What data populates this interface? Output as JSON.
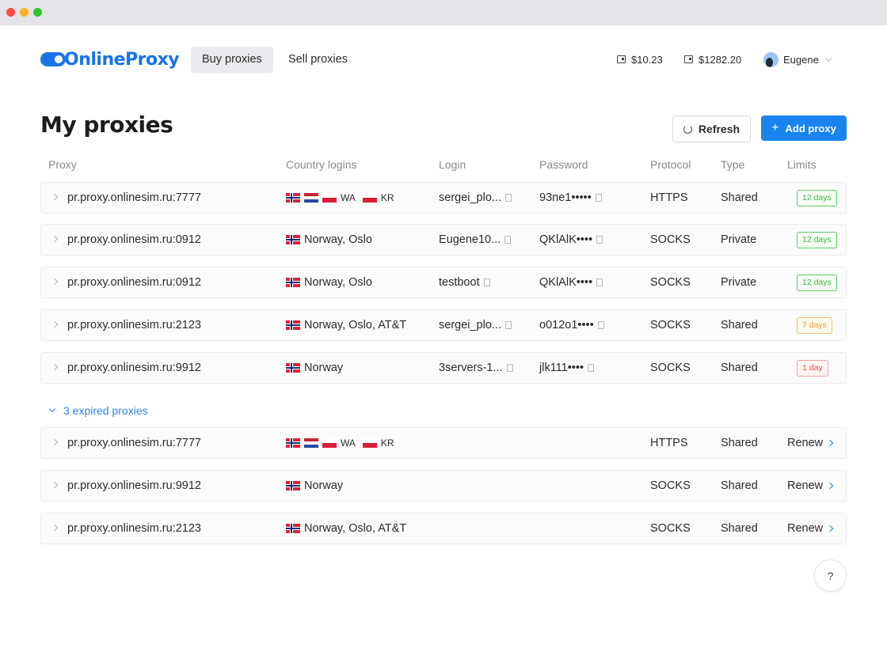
{
  "window": {
    "controls": [
      "close",
      "minimize",
      "maximize"
    ]
  },
  "header": {
    "logo_text": "OnlineProxy",
    "nav": [
      {
        "label": "Buy proxies",
        "active": true
      },
      {
        "label": "Sell proxies",
        "active": false
      }
    ],
    "balances": [
      {
        "icon": "wallet-icon",
        "value": "$10.23"
      },
      {
        "icon": "wallet-icon",
        "value": "$1282.20"
      }
    ],
    "user": {
      "name": "Eugene",
      "icon": "chevron-down-icon"
    }
  },
  "page": {
    "title": "My proxies",
    "refresh_label": "Refresh",
    "add_label": "Add proxy",
    "add_icon": "+"
  },
  "table": {
    "columns": [
      "Proxy",
      "Country logins",
      "Login",
      "Password",
      "Protocol",
      "Type",
      "Limits"
    ],
    "active": [
      {
        "proxy": "pr.proxy.onlinesim.ru:7777",
        "flags": [
          "NO",
          "NL",
          "PL",
          "PL"
        ],
        "codes": [
          "",
          "",
          "WA",
          "KR"
        ],
        "country_text": "",
        "login": "sergei_plo...",
        "password": "93ne1•••••",
        "protocol": "HTTPS",
        "type": "Shared",
        "limit": "12 days",
        "limit_status": "green"
      },
      {
        "proxy": "pr.proxy.onlinesim.ru:0912",
        "flags": [
          "NO"
        ],
        "codes": [
          ""
        ],
        "country_text": "Norway, Oslo",
        "login": "Eugene10...",
        "password": "QKlAlK••••",
        "protocol": "SOCKS",
        "type": "Private",
        "limit": "12 days",
        "limit_status": "green"
      },
      {
        "proxy": "pr.proxy.onlinesim.ru:0912",
        "flags": [
          "NO"
        ],
        "codes": [
          ""
        ],
        "country_text": "Norway, Oslo",
        "login": "testboot",
        "password": "QKlAlK••••",
        "protocol": "SOCKS",
        "type": "Private",
        "limit": "12 days",
        "limit_status": "green"
      },
      {
        "proxy": "pr.proxy.onlinesim.ru:2123",
        "flags": [
          "NO"
        ],
        "codes": [
          ""
        ],
        "country_text": "Norway, Oslo, AT&T",
        "login": "sergei_plo...",
        "password": "o012o1••••",
        "protocol": "SOCKS",
        "type": "Shared",
        "limit": "7 days",
        "limit_status": "orange"
      },
      {
        "proxy": "pr.proxy.onlinesim.ru:9912",
        "flags": [
          "NO"
        ],
        "codes": [
          ""
        ],
        "country_text": "Norway",
        "login": "3servers-1...",
        "password": "jlk111••••",
        "protocol": "SOCKS",
        "type": "Shared",
        "limit": "1 day",
        "limit_status": "red"
      }
    ],
    "expired_label": "3 expired proxies",
    "expired": [
      {
        "proxy": "pr.proxy.onlinesim.ru:7777",
        "flags": [
          "NO",
          "NL",
          "PL",
          "PL"
        ],
        "codes": [
          "",
          "",
          "WA",
          "KR"
        ],
        "country_text": "",
        "protocol": "HTTPS",
        "type": "Shared",
        "action": "Renew"
      },
      {
        "proxy": "pr.proxy.onlinesim.ru:9912",
        "flags": [
          "NO"
        ],
        "codes": [
          ""
        ],
        "country_text": "Norway",
        "protocol": "SOCKS",
        "type": "Shared",
        "action": "Renew"
      },
      {
        "proxy": "pr.proxy.onlinesim.ru:2123",
        "flags": [
          "NO"
        ],
        "codes": [
          ""
        ],
        "country_text": "Norway, Oslo, AT&T",
        "protocol": "SOCKS",
        "type": "Shared",
        "action": "Renew"
      }
    ]
  },
  "help_label": "?"
}
